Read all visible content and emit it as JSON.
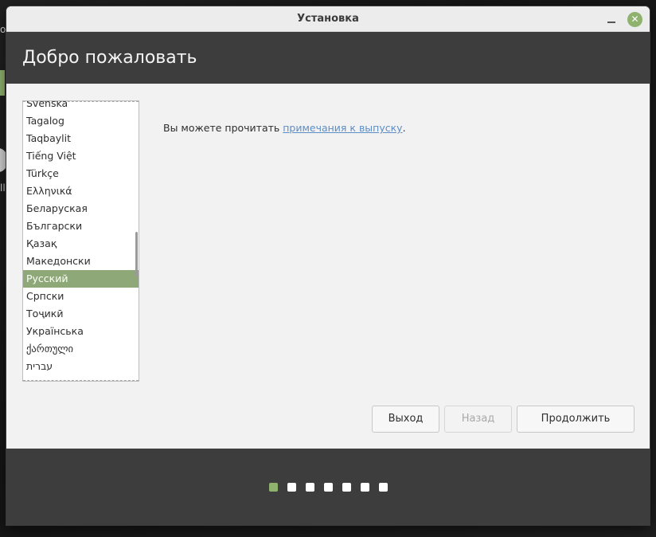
{
  "window": {
    "title": "Установка",
    "minimize_icon": "minimize-icon",
    "close_icon": "close-icon",
    "close_glyph": "✕"
  },
  "header": {
    "title": "Добро пожаловать"
  },
  "languages": {
    "items": [
      "Svenska",
      "Tagalog",
      "Taqbaylit",
      "Tiếng Việt",
      "Türkçe",
      "Ελληνικά",
      "Беларуская",
      "Български",
      "Қазақ",
      "Македонски",
      "Русский",
      "Српски",
      "Тоҷикӣ",
      "Українська",
      "ქართული",
      "עברית"
    ],
    "selected": "Русский"
  },
  "notes": {
    "prefix": "Вы можете прочитать ",
    "link": "примечания к выпуску",
    "suffix": "."
  },
  "buttons": {
    "quit": "Выход",
    "back": "Назад",
    "continue": "Продолжить"
  },
  "progress": {
    "total_steps": 7,
    "current_step": 1
  },
  "colors": {
    "accent": "#8fb26e",
    "selection": "#8fa878",
    "header_bg": "#3d3d3d",
    "link": "#5c8ec6"
  }
}
